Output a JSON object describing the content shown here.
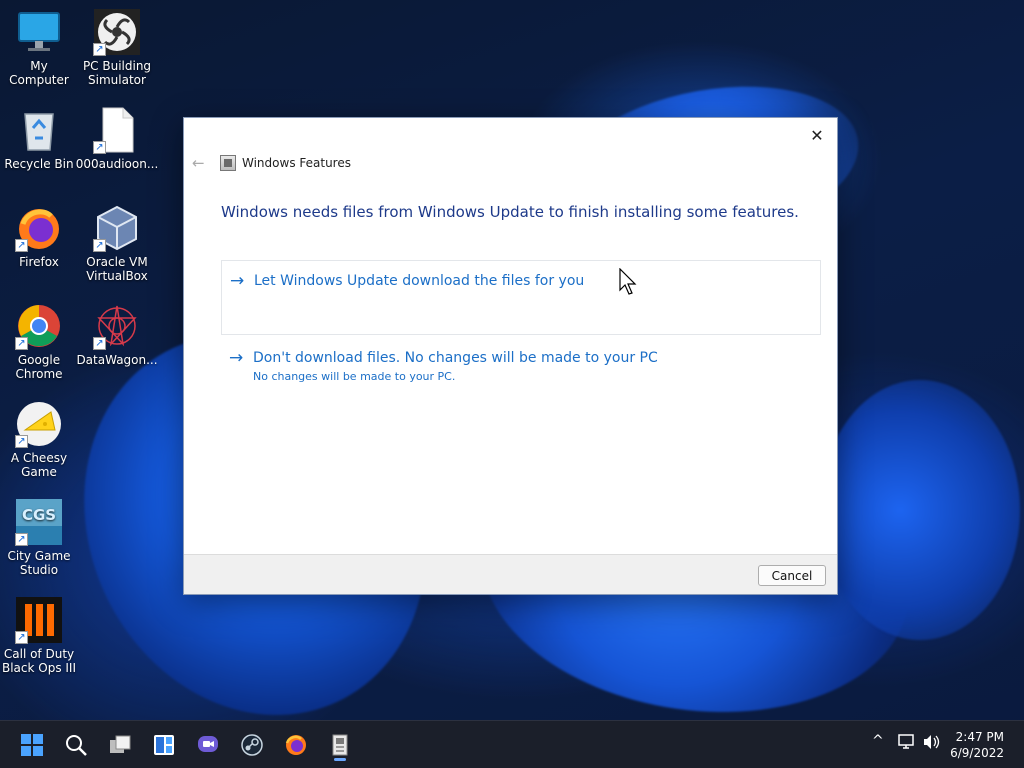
{
  "desktop": {
    "icons": [
      {
        "label": "My Computer",
        "icon": "monitor-icon"
      },
      {
        "label": "PC Building Simulator",
        "icon": "fan-icon"
      },
      {
        "label": "Recycle Bin",
        "icon": "recycle-bin-icon"
      },
      {
        "label": "000audioon...",
        "icon": "file-icon"
      },
      {
        "label": "Firefox",
        "icon": "firefox-icon"
      },
      {
        "label": "Oracle VM VirtualBox",
        "icon": "virtualbox-icon"
      },
      {
        "label": "Google Chrome",
        "icon": "chrome-icon"
      },
      {
        "label": "DataWagon...",
        "icon": "datawagon-icon"
      },
      {
        "label": "A Cheesy Game",
        "icon": "cheese-icon"
      },
      {
        "label": "City Game Studio",
        "icon": "cgs-icon"
      },
      {
        "label": "Call of Duty Black Ops III",
        "icon": "black-ops-icon"
      }
    ]
  },
  "dialog": {
    "title": "Windows Features",
    "heading": "Windows needs files from Windows Update to finish installing some features.",
    "options": [
      {
        "main": "Let Windows Update download the files for you",
        "sub": ""
      },
      {
        "main": "Don't download files. No changes will be made to your PC",
        "sub": "No changes will be made to your PC."
      }
    ],
    "cancel_label": "Cancel",
    "close_glyph": "✕",
    "back_glyph": "←",
    "arrow_glyph": "→"
  },
  "taskbar": {
    "apps": [
      "start-icon",
      "search-icon",
      "task-view-icon",
      "widgets-icon",
      "chat-icon",
      "steam-icon",
      "firefox-icon",
      "windows-features-icon"
    ],
    "tray_chevron": "^",
    "time": "2:47 PM",
    "date": "6/9/2022"
  },
  "colors": {
    "accent": "#1c6fc7",
    "heading": "#1e3a8a",
    "taskbar": "#1b1f2a"
  }
}
